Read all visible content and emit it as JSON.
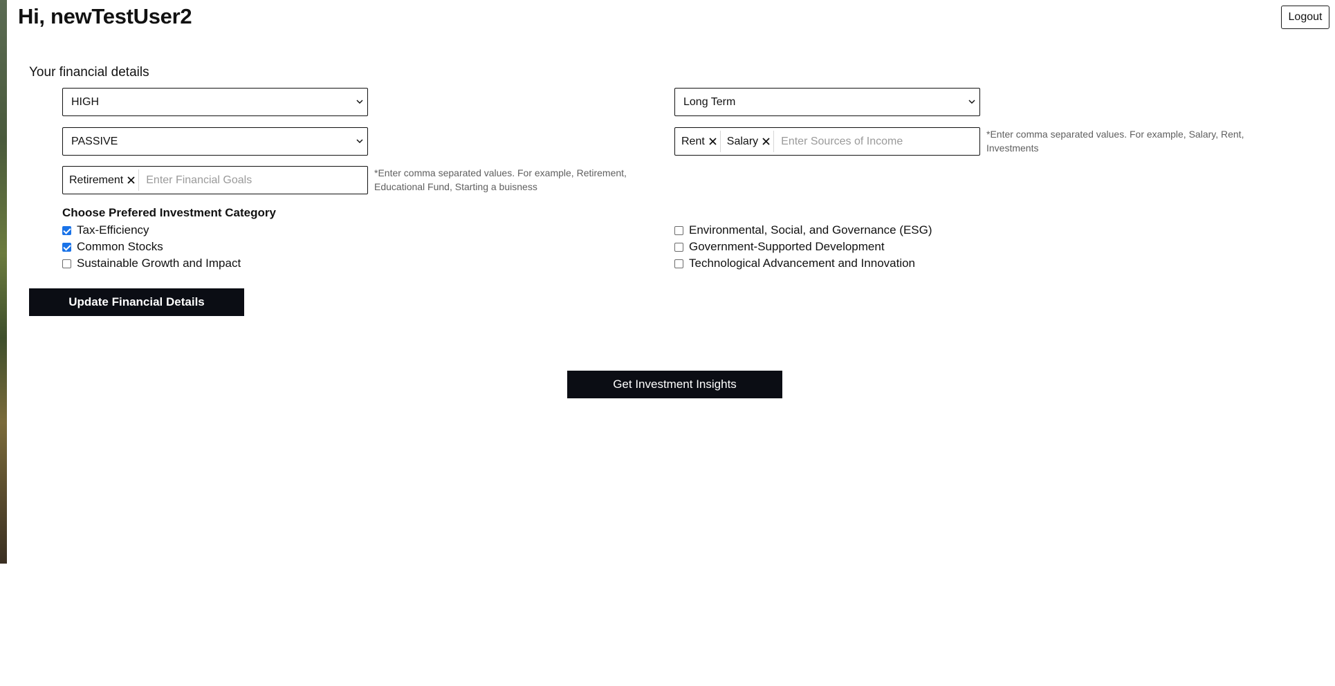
{
  "header": {
    "greeting": "Hi, newTestUser2",
    "logout_label": "Logout"
  },
  "form": {
    "section_title": "Your financial details",
    "risk_select": {
      "value": "HIGH"
    },
    "horizon_select": {
      "value": "Long Term"
    },
    "style_select": {
      "value": "PASSIVE"
    },
    "income_sources": {
      "tags": [
        "Rent",
        "Salary"
      ],
      "placeholder": "Enter Sources of Income",
      "hint": "*Enter comma separated values. For example, Salary, Rent, Investments"
    },
    "financial_goals": {
      "tags": [
        "Retirement"
      ],
      "placeholder": "Enter Financial Goals",
      "hint": "*Enter comma separated values. For example, Retirement, Educational Fund, Starting a buisness"
    },
    "category_title": "Choose Prefered Investment Category",
    "categories_left": [
      {
        "label": "Tax-Efficiency",
        "checked": true
      },
      {
        "label": "Common Stocks",
        "checked": true
      },
      {
        "label": "Sustainable Growth and Impact",
        "checked": false
      }
    ],
    "categories_right": [
      {
        "label": "Environmental, Social, and Governance (ESG)",
        "checked": false
      },
      {
        "label": "Government-Supported Development",
        "checked": false
      },
      {
        "label": "Technological Advancement and Innovation",
        "checked": false
      }
    ],
    "update_button_label": "Update Financial Details"
  },
  "insights_button_label": "Get Investment Insights",
  "colors": {
    "button_bg": "#0b0d14",
    "checkbox_checked": "#1a73e8"
  },
  "icons": {
    "remove_tag": "close-icon",
    "select_arrow": "chevron-down-icon"
  }
}
